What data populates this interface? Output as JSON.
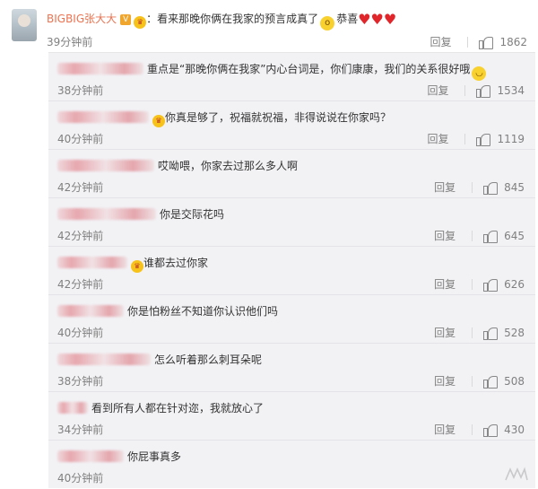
{
  "top_comment": {
    "username": "BIGBIG张大大",
    "separator": "：",
    "text": "看来那晚你俩在我家的预言成真了",
    "text2": "恭喜",
    "time": "39分钟前",
    "reply_label": "回复",
    "likes": "1862",
    "icons": [
      "avatar",
      "verified-badge-icon",
      "crown-icon",
      "shocked-emoji-icon",
      "heart-icon",
      "heart-icon",
      "heart-icon"
    ]
  },
  "replies": [
    {
      "text": "重点是“那晚你俩在我家”内心台词是，你们康康，我们的关系很好哦",
      "emoji": "blushing-emoji-icon",
      "time": "38分钟前",
      "reply_label": "回复",
      "likes": "1534"
    },
    {
      "text": "你真是够了，祝福就祝福，非得说说在你家吗？",
      "time": "40分钟前",
      "reply_label": "回复",
      "likes": "1119"
    },
    {
      "text": "哎呦喂，你家去过那么多人啊",
      "time": "42分钟前",
      "reply_label": "回复",
      "likes": "845"
    },
    {
      "text": "你是交际花吗",
      "time": "42分钟前",
      "reply_label": "回复",
      "likes": "645"
    },
    {
      "text": "谁都去过你家",
      "time": "42分钟前",
      "reply_label": "回复",
      "likes": "626"
    },
    {
      "text": "你是怕粉丝不知道你认识他们吗",
      "time": "40分钟前",
      "reply_label": "回复",
      "likes": "528"
    },
    {
      "text": "怎么听着那么刺耳朵呢",
      "time": "38分钟前",
      "reply_label": "回复",
      "likes": "508"
    },
    {
      "text": "看到所有人都在针对迩，我就放心了",
      "time": "34分钟前",
      "reply_label": "回复",
      "likes": "430"
    },
    {
      "text": "你屁事真多",
      "time": "40分钟前"
    }
  ],
  "colors": {
    "username": "#eb7350",
    "subpanel_bg": "#f2f2f5",
    "meta": "#808080",
    "heart": "#e0262b"
  }
}
